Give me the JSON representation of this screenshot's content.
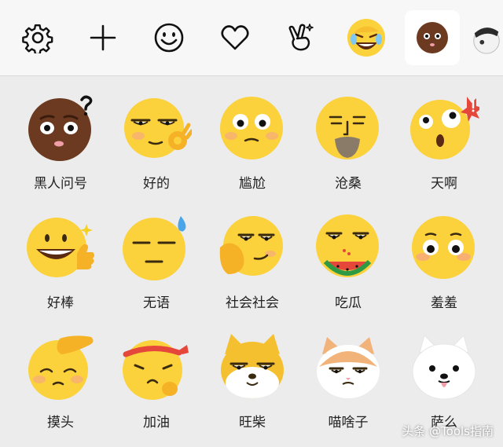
{
  "toolbar": {
    "icons": [
      "gear-icon",
      "plus-icon",
      "smile-icon",
      "heart-icon",
      "peace-hand-icon",
      "laughing-emoji-tab",
      "dark-emoji-tab",
      "hat-emoji-tab"
    ],
    "active_tab": "dark-emoji-tab"
  },
  "stickers": [
    {
      "label": "黑人问号"
    },
    {
      "label": "好的"
    },
    {
      "label": "尴尬"
    },
    {
      "label": "沧桑"
    },
    {
      "label": "天啊"
    },
    {
      "label": "好棒"
    },
    {
      "label": "无语"
    },
    {
      "label": "社会社会"
    },
    {
      "label": "吃瓜"
    },
    {
      "label": "羞羞"
    },
    {
      "label": "摸头"
    },
    {
      "label": "加油"
    },
    {
      "label": "旺柴"
    },
    {
      "label": "喵啥子"
    },
    {
      "label": "萨么"
    }
  ],
  "watermark": "头条 @Tools指南",
  "colors": {
    "emoji_yellow": "#fbd13c",
    "dark_skin": "#6b3a20",
    "accent_red": "#e5473b"
  }
}
